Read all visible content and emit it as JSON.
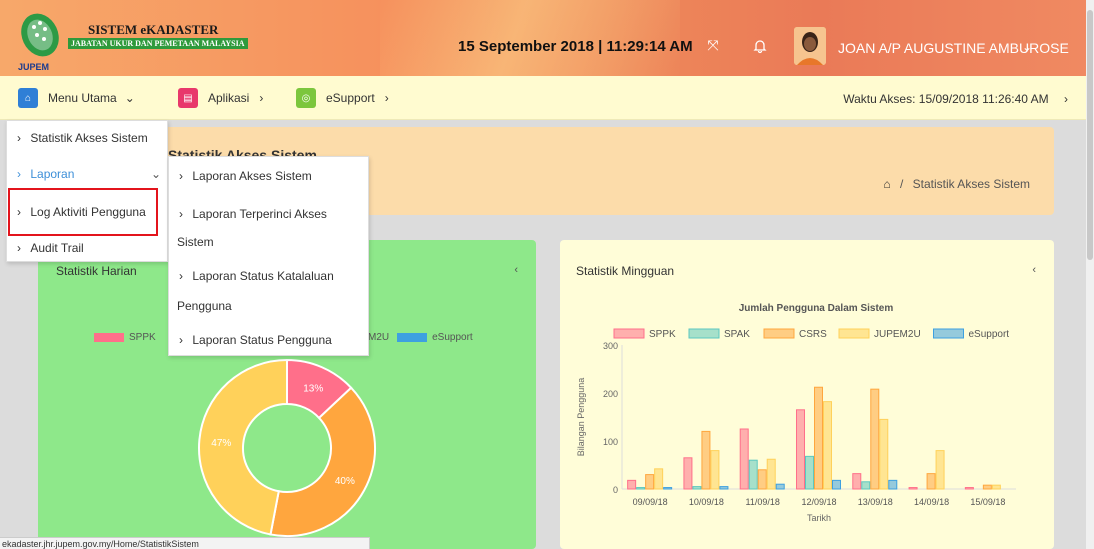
{
  "header": {
    "logo_title": "SISTEM eKADASTER",
    "logo_subtitle": "JABATAN UKUR DAN PEMETAAN MALAYSIA",
    "logo_brand": "JUPEM",
    "datetime": "15 September 2018 | 11:29:14 AM",
    "username": "JOAN A/P AUGUSTINE AMBUROSE"
  },
  "nav": {
    "menu_utama": "Menu Utama",
    "aplikasi": "Aplikasi",
    "esupport": "eSupport",
    "waktu_akses": "Waktu Akses: 15/09/2018 11:26:40 AM"
  },
  "page": {
    "heading": "Statistik Akses Sistem",
    "breadcrumb_current": "Statistik Akses Sistem"
  },
  "menu_primary": [
    "Statistik Akses Sistem",
    "Laporan",
    "Log Aktiviti Pengguna",
    "Audit Trail"
  ],
  "menu_laporan": [
    "Laporan Akses Sistem",
    "Laporan Terperinci Akses",
    "Sistem",
    "Laporan Status Katalaluan",
    "Pengguna",
    "Laporan Status Pengguna"
  ],
  "cards": {
    "daily_title": "Statistik Harian",
    "weekly_title": "Statistik Mingguan"
  },
  "daily_legend_visible": [
    "SPPK",
    "M2U",
    "eSupport"
  ],
  "status_url": "ekadaster.jhr.jupem.gov.my/Home/StatistikSistem",
  "colors": {
    "sppk": "#ff6f8a",
    "spak": "#5cc8c0",
    "csrs": "#ffa63e",
    "jupem2u": "#ffd15a",
    "esupport": "#3ea0e0"
  },
  "chart_data": [
    {
      "type": "pie",
      "title": "",
      "labels": [
        "SPPK",
        "CSRS",
        "JUPEM2U"
      ],
      "values": [
        13,
        40,
        47
      ],
      "value_labels": [
        "13%",
        "40%",
        "47%"
      ]
    },
    {
      "type": "bar",
      "title": "Jumlah Pengguna Dalam Sistem",
      "xlabel": "Tarikh",
      "ylabel": "Bilangan Pengguna",
      "ylim": [
        0,
        300
      ],
      "yticks": [
        0,
        100,
        200,
        300
      ],
      "categories": [
        "09/09/18",
        "10/09/18",
        "11/09/18",
        "12/09/18",
        "13/09/18",
        "14/09/18",
        "15/09/18"
      ],
      "series": [
        {
          "name": "SPPK",
          "values": [
            18,
            65,
            125,
            165,
            32,
            3,
            3
          ]
        },
        {
          "name": "SPAK",
          "values": [
            3,
            5,
            60,
            68,
            15,
            0,
            0
          ]
        },
        {
          "name": "CSRS",
          "values": [
            30,
            120,
            40,
            212,
            208,
            32,
            8
          ]
        },
        {
          "name": "JUPEM2U",
          "values": [
            42,
            80,
            62,
            182,
            145,
            80,
            8
          ]
        },
        {
          "name": "eSupport",
          "values": [
            3,
            5,
            10,
            18,
            18,
            0,
            0
          ]
        }
      ]
    }
  ]
}
